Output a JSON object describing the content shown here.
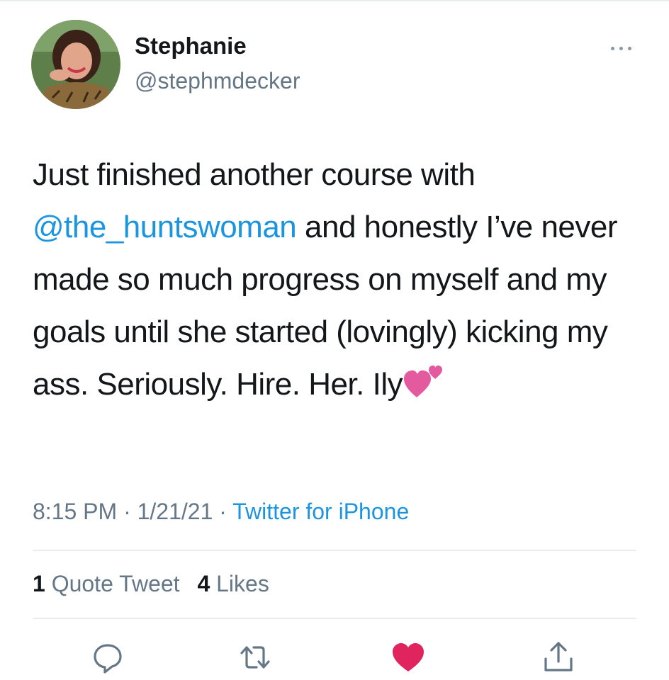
{
  "user": {
    "display_name": "Stephanie",
    "handle": "@stephmdecker"
  },
  "tweet": {
    "line1": "Just finished another course with",
    "mention": "@the_huntswoman",
    "after_mention": " and honestly I’ve never made so much progress on myself and my goals until she started (lovingly) kicking my ass. Seriously. Hire. Her. Ily",
    "emoji": "two-hearts"
  },
  "meta": {
    "time": "8:15 PM",
    "separator1": " · ",
    "date": "1/21/21",
    "separator2": " · ",
    "source": "Twitter for iPhone"
  },
  "stats": {
    "quote_count": "1",
    "quote_label": " Quote Tweet",
    "like_count": "4",
    "like_label": " Likes"
  },
  "actions": {
    "reply_icon": "speech-bubble",
    "retweet_icon": "retweet-arrows",
    "like_icon": "heart-filled",
    "share_icon": "share-upload",
    "like_color": "#e0245e",
    "icon_color": "#657786"
  },
  "colors": {
    "link": "#1b95e0",
    "secondary": "#657786",
    "text": "#14171a",
    "divider": "#e6ecf0"
  }
}
